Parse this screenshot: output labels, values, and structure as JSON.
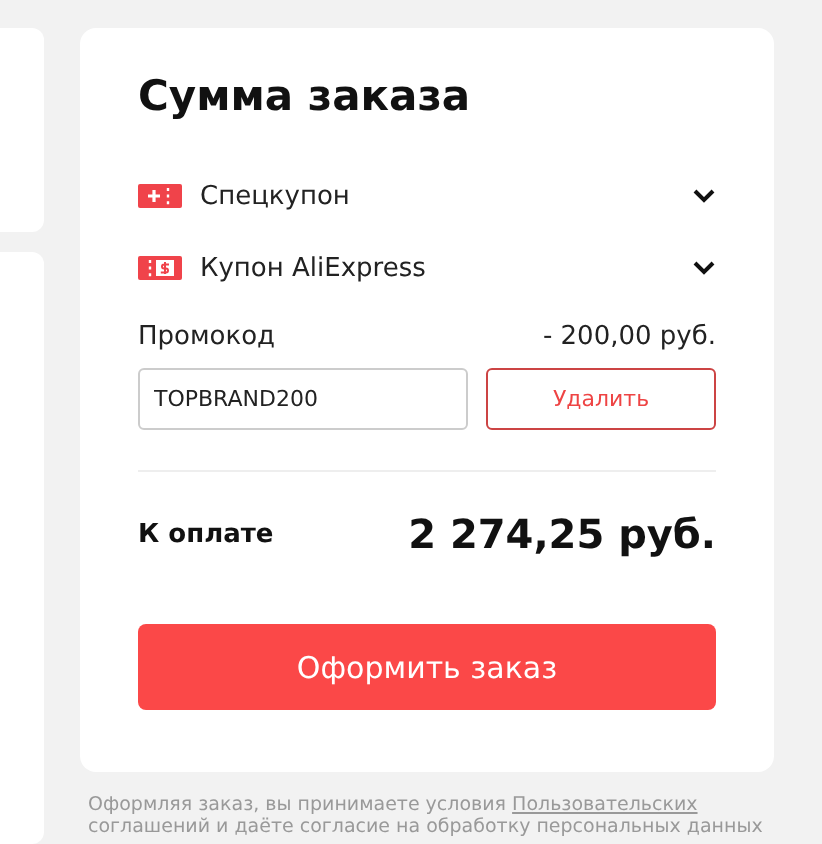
{
  "summary": {
    "title": "Сумма заказа",
    "coupons": [
      {
        "kind": "plus",
        "label": "Спецкупон",
        "expanded": false
      },
      {
        "kind": "dollar",
        "label": "Купон AliExpress",
        "expanded": false
      }
    ],
    "promo": {
      "label": "Промокод",
      "discount": "- 200,00 руб.",
      "value": "TOPBRAND200",
      "remove_button": "Удалить"
    },
    "total": {
      "label": "К оплате",
      "amount": "2 274,25 руб."
    },
    "checkout_button": "Оформить заказ"
  },
  "footer": {
    "text": "Оформляя заказ, вы принимаете условия ",
    "link": "Пользовательских",
    "text_2": "соглашений и даёте согласие на обработку персональных данных"
  }
}
